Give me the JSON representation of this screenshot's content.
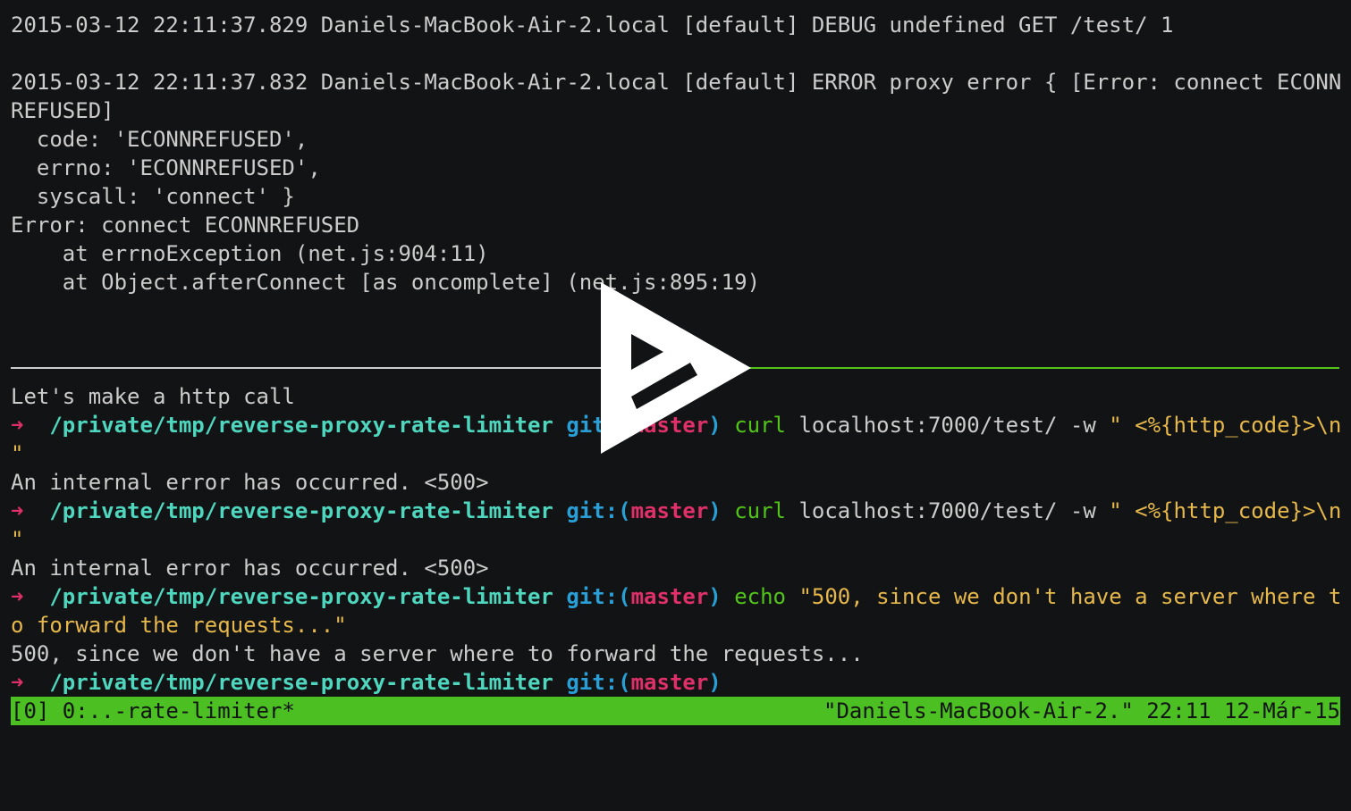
{
  "log": {
    "debug_line": "2015-03-12 22:11:37.829 Daniels-MacBook-Air-2.local [default] DEBUG undefined GET /test/ 1",
    "error_line_1": "2015-03-12 22:11:37.832 Daniels-MacBook-Air-2.local [default] ERROR proxy error { [Error: connect ECONN",
    "error_line_2": "REFUSED]",
    "code_line": "  code: 'ECONNREFUSED',",
    "errno_line": "  errno: 'ECONNREFUSED',",
    "syscall_line": "  syscall: 'connect' }",
    "error_msg": "Error: connect ECONNREFUSED",
    "stack_1": "    at errnoException (net.js:904:11)",
    "stack_2": "    at Object.afterConnect [as oncomplete] (net.js:895:19)"
  },
  "shell": {
    "intro": "Let's make a http call",
    "prompt_arrow": "➜",
    "prompt_path": "/private/tmp/reverse-proxy-rate-limiter",
    "prompt_git_open": "git:(",
    "prompt_branch": "master",
    "prompt_git_close": ")",
    "cmd_curl": "curl",
    "curl_args": "localhost:7000/test/ -w ",
    "curl_format": "\" <%{http_code}>\\n",
    "curl_format_cont": "\"",
    "response": "An internal error has occurred. <500>",
    "cmd_echo": "echo",
    "echo_arg_1": "\"500, since we don't have a server where t",
    "echo_arg_2": "o forward the requests...\"",
    "echo_output": "500, since we don't have a server where to forward the requests..."
  },
  "status_bar": {
    "left": "[0] 0:..-rate-limiter*",
    "right": "\"Daniels-MacBook-Air-2.\" 22:11 12-Már-15"
  },
  "colors": {
    "background": "#121314",
    "status_bar": "#4cbf22",
    "prompt_arrow": "#e0306a",
    "prompt_path": "#4fd6be",
    "git": "#2a9fd6",
    "command": "#52c41a",
    "string": "#e6b84c"
  },
  "overlay": {
    "icon": "play-icon"
  }
}
